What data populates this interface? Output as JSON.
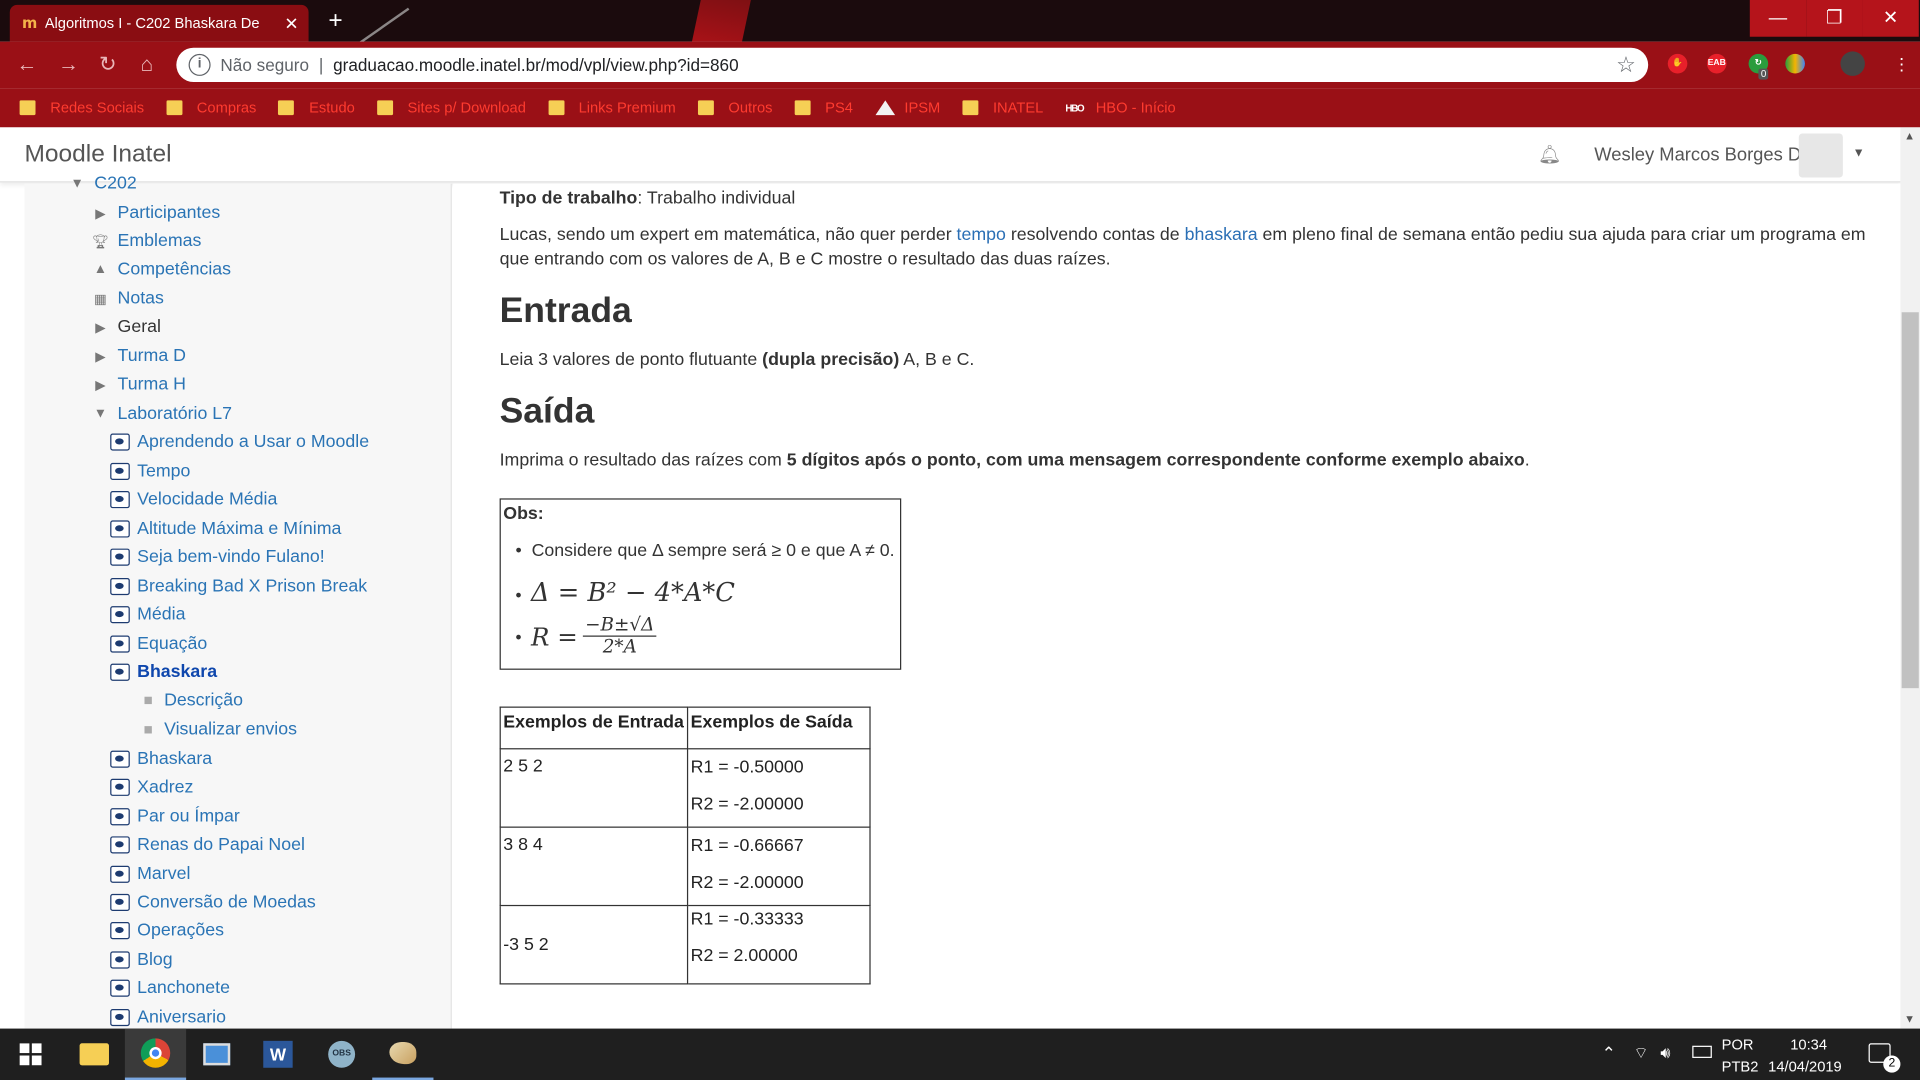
{
  "browser": {
    "tab_title": "Algoritmos I - C202 Bhaskara De",
    "tab_favicon": "m",
    "address_security": "Não seguro",
    "address_url": "graduacao.moodle.inatel.br/mod/vpl/view.php?id=860",
    "window_buttons": [
      "minimize",
      "restore",
      "close"
    ],
    "extension_badge": "0",
    "extension_label": "EAB",
    "bookmarks": [
      {
        "label": "Redes Sociais",
        "icon": "folder"
      },
      {
        "label": "Compras",
        "icon": "folder"
      },
      {
        "label": "Estudo",
        "icon": "folder"
      },
      {
        "label": "Sites p/ Download",
        "icon": "folder"
      },
      {
        "label": "Links Premium",
        "icon": "folder"
      },
      {
        "label": "Outros",
        "icon": "folder"
      },
      {
        "label": "PS4",
        "icon": "folder"
      },
      {
        "label": "IPSM",
        "icon": "triangle"
      },
      {
        "label": "INATEL",
        "icon": "folder"
      },
      {
        "label": "HBO - Início",
        "icon": "hbo"
      }
    ],
    "hbo_logo": "HBO",
    "accent": "#9a1016"
  },
  "header": {
    "brand": "Moodle Inatel",
    "user": "Wesley Marcos Borges D"
  },
  "sidebar": {
    "items": [
      {
        "label": "C202",
        "icon": "caret-down"
      },
      {
        "label": "Participantes",
        "icon": "caret-right"
      },
      {
        "label": "Emblemas",
        "icon": "trophy"
      },
      {
        "label": "Competências",
        "icon": "competency"
      },
      {
        "label": "Notas",
        "icon": "table"
      },
      {
        "label": "Geral",
        "icon": "caret-right"
      },
      {
        "label": "Turma D",
        "icon": "caret-right"
      },
      {
        "label": "Turma H",
        "icon": "caret-right"
      },
      {
        "label": "Laboratório L7",
        "icon": "caret-down"
      },
      {
        "label": "Aprendendo a Usar o Moodle",
        "icon": "vpl"
      },
      {
        "label": "Tempo",
        "icon": "vpl"
      },
      {
        "label": "Velocidade Média",
        "icon": "vpl"
      },
      {
        "label": "Altitude Máxima e Mínima",
        "icon": "vpl"
      },
      {
        "label": "Seja bem-vindo Fulano!",
        "icon": "vpl"
      },
      {
        "label": "Breaking Bad X Prison Break",
        "icon": "vpl"
      },
      {
        "label": "Média",
        "icon": "vpl"
      },
      {
        "label": "Equação",
        "icon": "vpl"
      },
      {
        "label": "Bhaskara",
        "icon": "vpl"
      },
      {
        "label": "Descrição",
        "icon": "square"
      },
      {
        "label": "Visualizar envios",
        "icon": "square"
      },
      {
        "label": "Bhaskara",
        "icon": "vpl"
      },
      {
        "label": "Xadrez",
        "icon": "vpl"
      },
      {
        "label": "Par ou Ímpar",
        "icon": "vpl"
      },
      {
        "label": "Renas do Papai Noel",
        "icon": "vpl"
      },
      {
        "label": "Marvel",
        "icon": "vpl"
      },
      {
        "label": "Conversão de Moedas",
        "icon": "vpl"
      },
      {
        "label": "Operações",
        "icon": "vpl"
      },
      {
        "label": "Blog",
        "icon": "vpl"
      },
      {
        "label": "Lanchonete",
        "icon": "vpl"
      },
      {
        "label": "Aniversario",
        "icon": "vpl"
      }
    ]
  },
  "content": {
    "tipo_label": "Tipo de trabalho",
    "tipo_value": ": Trabalho individual",
    "intro_1": "Lucas, sendo um expert em matemática, não quer perder ",
    "intro_link1": "tempo",
    "intro_2": " resolvendo contas de ",
    "intro_link2": "bhaskara",
    "intro_3": " em pleno final de semana então pediu sua ajuda para criar um programa em",
    "intro_line2": "que entrando com os valores de A, B e C mostre o resultado das duas raízes.",
    "entrada_title": "Entrada",
    "entrada_1": "Leia 3 valores de ponto flutuante ",
    "entrada_bold": "(dupla precisão)",
    "entrada_2": " A, B e C.",
    "saida_title": "Saída",
    "saida_1": "Imprima o resultado das raízes com ",
    "saida_bold": "5 dígitos após o ponto, com uma mensagem correspondente conforme exemplo abaixo",
    "saida_2": ".",
    "obs_title": "Obs:",
    "obs_item": "Considere que Δ sempre será ≥ 0 e que A ≠ 0.",
    "formula1": "Δ = B² − 4*A*C",
    "formula2_lhs": "R =",
    "formula2_num": "−B±√Δ",
    "formula2_den": "2*A",
    "table_headers": [
      "Exemplos de Entrada",
      "Exemplos de Saída"
    ],
    "table_rows": [
      {
        "input": "2 5 2",
        "out1": "R1 = -0.50000",
        "out2": "R2 = -2.00000"
      },
      {
        "input": "3 8 4",
        "out1": "R1 = -0.66667",
        "out2": "R2 = -2.00000"
      },
      {
        "input": "-3 5 2",
        "out1": "R1 = -0.33333",
        "out2": "R2 = 2.00000"
      }
    ]
  },
  "taskbar": {
    "language": "POR",
    "layout": "PTB2",
    "time": "10:34",
    "date": "14/04/2019",
    "notifications": "2"
  }
}
